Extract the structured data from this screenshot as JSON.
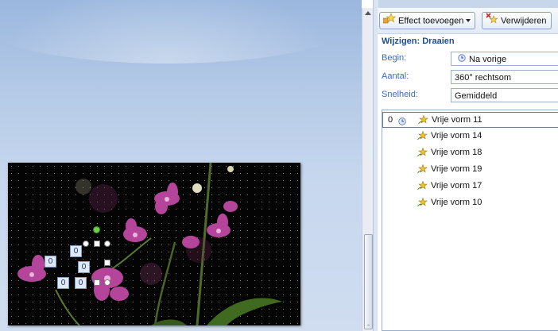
{
  "toolbar": {
    "add_effect_label": "Effect toevoegen",
    "remove_label": "Verwijderen"
  },
  "pane": {
    "section_title": "Wijzigen: Draaien",
    "begin_label": "Begin:",
    "begin_value": "Na vorige",
    "amount_label": "Aantal:",
    "amount_value": "360° rechtsom",
    "speed_label": "Snelheid:",
    "speed_value": "Gemiddeld"
  },
  "animation_list": [
    {
      "index": "0",
      "name": "Vrije vorm 11"
    },
    {
      "index": "",
      "name": "Vrije vorm 14"
    },
    {
      "index": "",
      "name": "Vrije vorm 18"
    },
    {
      "index": "",
      "name": "Vrije vorm 19"
    },
    {
      "index": "",
      "name": "Vrije vorm 17"
    },
    {
      "index": "",
      "name": "Vrije vorm 10"
    }
  ],
  "slide_tags": [
    "0",
    "0",
    "0",
    "0",
    "0"
  ],
  "colors": {
    "accent": "#1f4e8c",
    "label": "#3b6db3",
    "canvas": "#b6cbe7"
  }
}
